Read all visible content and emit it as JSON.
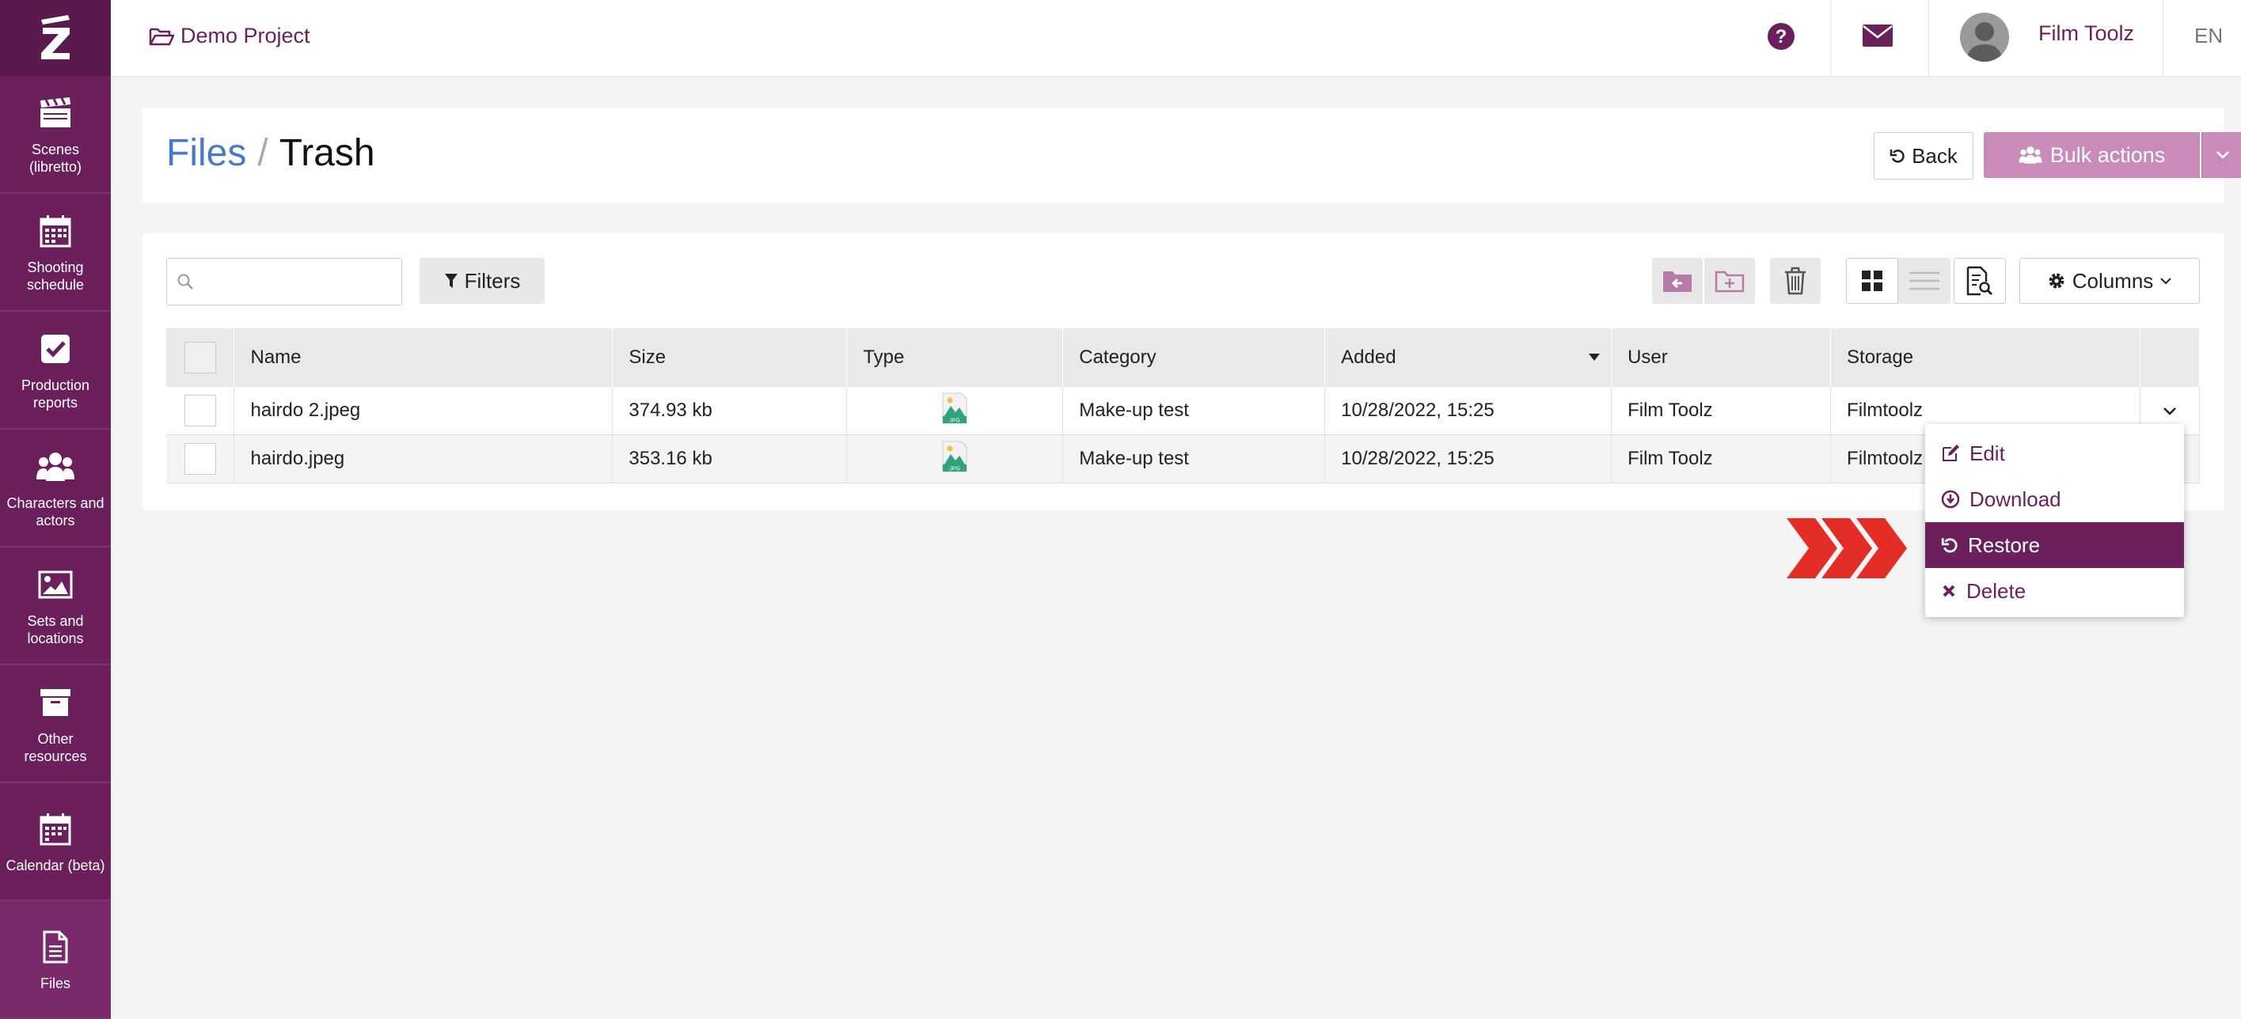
{
  "sidebar": {
    "items": [
      {
        "label": "Scenes (libretto)",
        "icon": "clapperboard-icon"
      },
      {
        "label": "Shooting schedule",
        "icon": "calendar-grid-icon"
      },
      {
        "label": "Production reports",
        "icon": "checkbox-icon"
      },
      {
        "label": "Characters and actors",
        "icon": "users-icon"
      },
      {
        "label": "Sets and locations",
        "icon": "image-icon"
      },
      {
        "label": "Other resources",
        "icon": "archive-box-icon"
      },
      {
        "label": "Calendar (beta)",
        "icon": "calendar-icon"
      },
      {
        "label": "Files",
        "icon": "file-icon"
      }
    ]
  },
  "topbar": {
    "project": "Demo Project",
    "user_name": "Film Toolz",
    "language": "EN"
  },
  "page": {
    "breadcrumb_parent": "Files",
    "breadcrumb_separator": "/",
    "breadcrumb_current": "Trash",
    "back_label": "Back",
    "bulk_actions_label": "Bulk actions"
  },
  "toolbar": {
    "search_value": "",
    "filters_label": "Filters",
    "columns_label": "Columns"
  },
  "table": {
    "columns": [
      "Name",
      "Size",
      "Type",
      "Category",
      "Added",
      "User",
      "Storage"
    ],
    "rows": [
      {
        "name": "hairdo 2.jpeg",
        "size": "374.93 kb",
        "type": "JPG",
        "category": "Make-up test",
        "added": "10/28/2022, 15:25",
        "user": "Film Toolz",
        "storage": "Filmtoolz"
      },
      {
        "name": "hairdo.jpeg",
        "size": "353.16 kb",
        "type": "JPG",
        "category": "Make-up test",
        "added": "10/28/2022, 15:25",
        "user": "Film Toolz",
        "storage": "Filmtoolz"
      }
    ]
  },
  "row_menu": {
    "items": [
      {
        "label": "Edit",
        "icon": "edit-icon"
      },
      {
        "label": "Download",
        "icon": "download-icon"
      },
      {
        "label": "Restore",
        "icon": "restore-icon"
      },
      {
        "label": "Delete",
        "icon": "close-icon"
      }
    ],
    "highlighted": "Restore"
  },
  "colors": {
    "brand": "#6b1f5b",
    "link": "#4a79c9",
    "bulk": "#c98bb8",
    "arrow": "#e52d27"
  }
}
